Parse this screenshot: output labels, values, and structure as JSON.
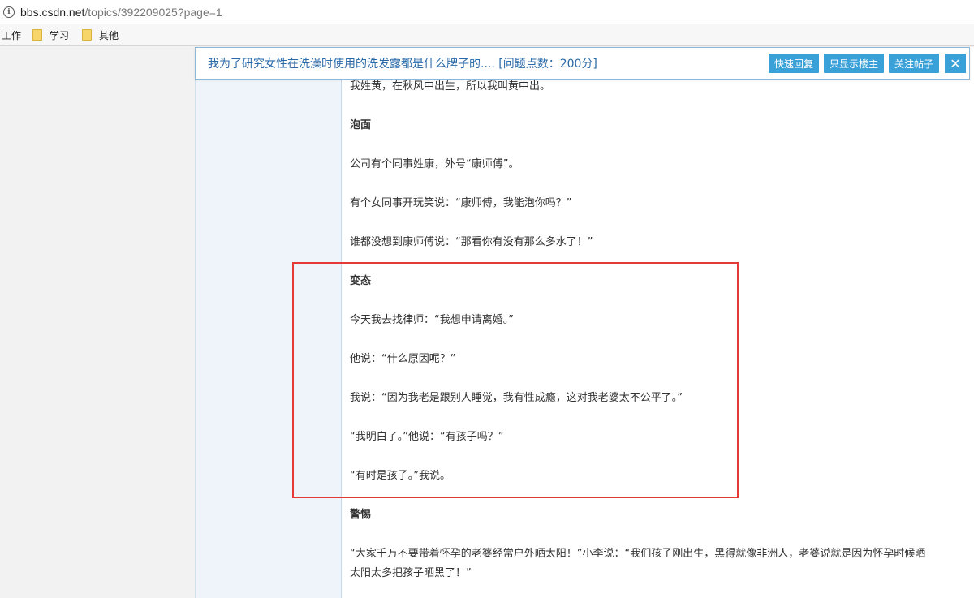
{
  "browser": {
    "url_host": "bbs.csdn.net",
    "url_path": "/topics/392209025?page=1"
  },
  "bookmarks": [
    "工作",
    "学习",
    "其他"
  ],
  "topic_bar": {
    "title": "我为了研究女性在洗澡时使用的洗发露都是什么牌子的.... [问题点数：200分]",
    "buttons": [
      "快速回复",
      "只显示楼主",
      "关注帖子"
    ],
    "close": "✕"
  },
  "content": {
    "lines": [
      {
        "text": "我姓黄，在秋风中出生，所以我叫黄中出。",
        "bold": false
      },
      {
        "text": "泡面",
        "bold": true
      },
      {
        "text": "公司有个同事姓康，外号“康师傅”。",
        "bold": false
      },
      {
        "text": "有个女同事开玩笑说：“康师傅，我能泡你吗？”",
        "bold": false
      },
      {
        "text": "谁都没想到康师傅说：“那看你有没有那么多水了！”",
        "bold": false
      },
      {
        "text": "变态",
        "bold": true
      },
      {
        "text": "今天我去找律师：“我想申请离婚。”",
        "bold": false
      },
      {
        "text": "他说：“什么原因呢？”",
        "bold": false
      },
      {
        "text": "我说：“因为我老是跟别人睡觉，我有性成瘾，这对我老婆太不公平了。”",
        "bold": false
      },
      {
        "text": "“我明白了。”他说：“有孩子吗？”",
        "bold": false
      },
      {
        "text": "“有时是孩子。”我说。",
        "bold": false
      },
      {
        "text": "警惕",
        "bold": true
      },
      {
        "text": "“大家千万不要带着怀孕的老婆经常户外晒太阳！”小李说：“我们孩子刚出生，黑得就像非洲人，老婆说就是因为怀孕时候晒",
        "bold": false
      },
      {
        "text": "太阳太多把孩子晒黑了！”",
        "bold": false
      }
    ]
  },
  "colors": {
    "highlight_border": "#e53935",
    "button_bg": "#3aa0d8",
    "title_text": "#2b6aa8"
  }
}
